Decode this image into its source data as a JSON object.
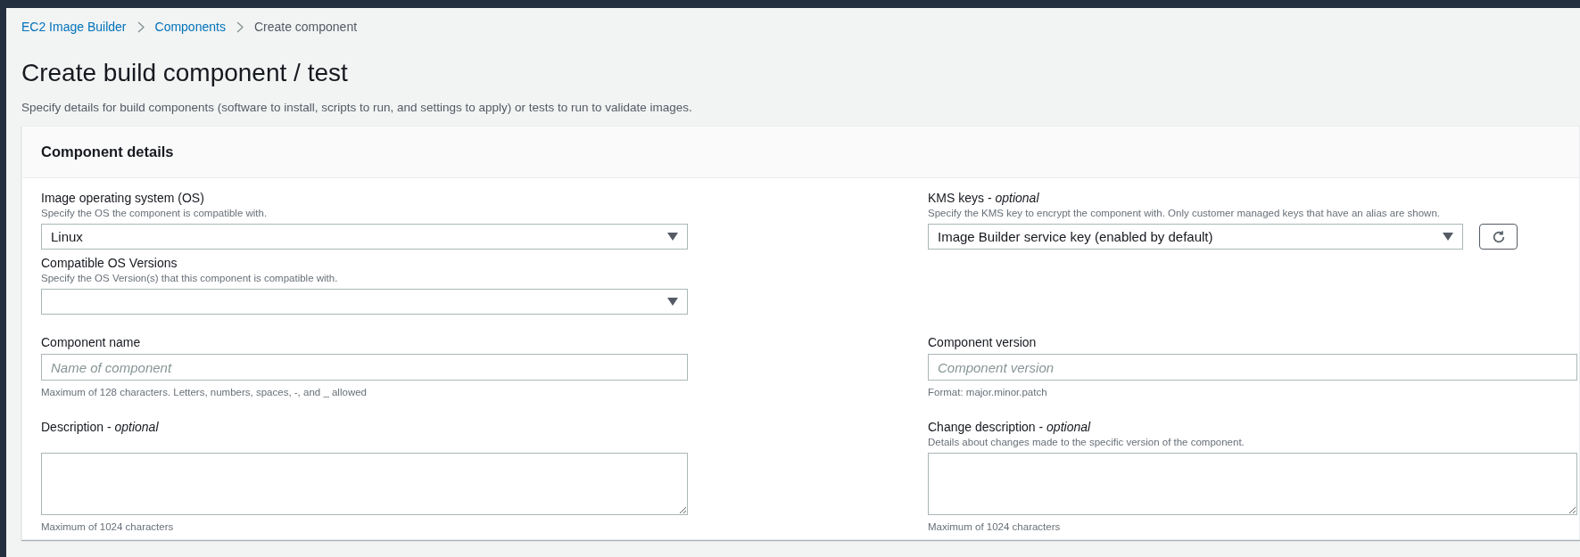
{
  "breadcrumbs": [
    {
      "label": "EC2 Image Builder",
      "link": true
    },
    {
      "label": "Components",
      "link": true
    },
    {
      "label": "Create component",
      "link": false
    }
  ],
  "title": "Create build component / test",
  "description": "Specify details for build components (software to install, scripts to run, and settings to apply) or tests to run to validate images.",
  "panel": {
    "title": "Component details",
    "rows": [
      {
        "left": [
          {
            "kind": "select",
            "label": "Image operating system (OS)",
            "hint": "Specify the OS the component is compatible with.",
            "value": "Linux"
          },
          {
            "kind": "select",
            "label": "Compatible OS Versions",
            "hint": "Specify the OS Version(s) that this component is compatible with."
          }
        ],
        "right": [
          {
            "kind": "select",
            "label": "KMS keys - *optional*",
            "hint": "Specify the KMS key to encrypt the component with. Only customer managed keys that have an alias are shown.",
            "value": "Image Builder service key (enabled by default)",
            "refresh": true
          }
        ]
      },
      {
        "left": [
          {
            "kind": "input",
            "label": "Component name",
            "placeholder": "Name of component",
            "footer": "Maximum of 128 characters. Letters, numbers, spaces, -, and _ allowed"
          }
        ],
        "right": [
          {
            "kind": "input",
            "label": "Component version",
            "placeholder": "Component version",
            "footer": "Format: major.minor.patch"
          }
        ]
      },
      {
        "left": [
          {
            "kind": "textarea",
            "label": "Description - *optional*",
            "footer": "Maximum of 1024 characters"
          }
        ],
        "right": [
          {
            "kind": "textarea",
            "label": "Change description - *optional*",
            "hint": "Details about changes made to the specific version of the component.",
            "footer": "Maximum of 1024 characters"
          }
        ]
      }
    ]
  }
}
